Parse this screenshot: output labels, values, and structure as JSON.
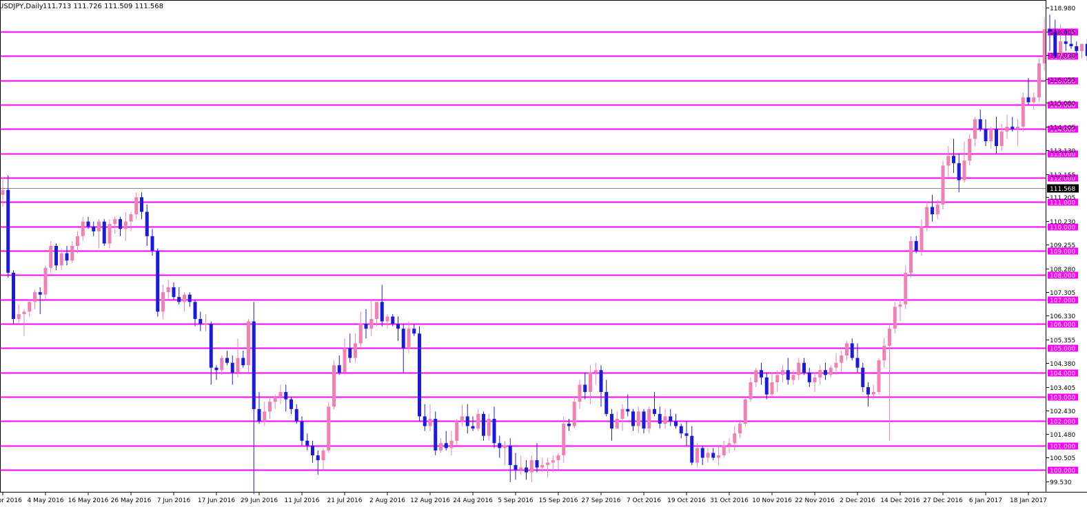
{
  "header": {
    "symbol": "USDJPY,Daily",
    "ohlc": "111.713 111.726 111.509 111.568"
  },
  "colors": {
    "bull": "#f27fb5",
    "bear": "#1a1adf",
    "level_line": "#ff00ff",
    "current_line": "#8a8a8a",
    "current_box": "#000000"
  },
  "chart_data": {
    "type": "candlestick",
    "title": "USDJPY,Daily",
    "ylim": [
      99.1,
      119.3
    ],
    "yticks": [
      "118.980",
      "118.005",
      "117.030",
      "116.055",
      "115.080",
      "114.105",
      "113.130",
      "112.155",
      "111.205",
      "110.230",
      "109.255",
      "108.280",
      "107.305",
      "106.330",
      "105.355",
      "104.380",
      "103.405",
      "102.430",
      "101.480",
      "100.505",
      "99.530"
    ],
    "level_lines": [
      "118.000",
      "117.000",
      "116.000",
      "115.000",
      "114.000",
      "113.000",
      "112.000",
      "111.000",
      "110.000",
      "109.000",
      "108.000",
      "107.000",
      "106.000",
      "105.000",
      "104.000",
      "103.000",
      "102.000",
      "101.000",
      "100.000"
    ],
    "current_price": "111.568",
    "x_labels": [
      {
        "label": "22 Apr 2016",
        "index": 0
      },
      {
        "label": "4 May 2016",
        "index": 8
      },
      {
        "label": "16 May 2016",
        "index": 16
      },
      {
        "label": "26 May 2016",
        "index": 24
      },
      {
        "label": "7 Jun 2016",
        "index": 32
      },
      {
        "label": "17 Jun 2016",
        "index": 40
      },
      {
        "label": "29 Jun 2016",
        "index": 48
      },
      {
        "label": "11 Jul 2016",
        "index": 56
      },
      {
        "label": "21 Jul 2016",
        "index": 64
      },
      {
        "label": "2 Aug 2016",
        "index": 72
      },
      {
        "label": "12 Aug 2016",
        "index": 80
      },
      {
        "label": "24 Aug 2016",
        "index": 88
      },
      {
        "label": "5 Sep 2016",
        "index": 96
      },
      {
        "label": "15 Sep 2016",
        "index": 104
      },
      {
        "label": "27 Sep 2016",
        "index": 112
      },
      {
        "label": "7 Oct 2016",
        "index": 120
      },
      {
        "label": "19 Oct 2016",
        "index": 128
      },
      {
        "label": "31 Oct 2016",
        "index": 136
      },
      {
        "label": "10 Nov 2016",
        "index": 144
      },
      {
        "label": "22 Nov 2016",
        "index": 152
      },
      {
        "label": "2 Dec 2016",
        "index": 160
      },
      {
        "label": "14 Dec 2016",
        "index": 168
      },
      {
        "label": "27 Dec 2016",
        "index": 176
      },
      {
        "label": "6 Jan 2017",
        "index": 184
      },
      {
        "label": "18 Jan 2017",
        "index": 192
      }
    ],
    "candles": [
      [
        111.3,
        112.0,
        110.8,
        111.5
      ],
      [
        111.5,
        112.1,
        107.9,
        108.1
      ],
      [
        108.1,
        108.2,
        106.0,
        106.2
      ],
      [
        106.2,
        106.8,
        106.0,
        106.4
      ],
      [
        106.4,
        106.6,
        105.5,
        106.5
      ],
      [
        106.5,
        107.0,
        106.3,
        106.9
      ],
      [
        106.9,
        107.4,
        106.6,
        107.3
      ],
      [
        107.3,
        107.5,
        106.4,
        107.2
      ],
      [
        107.2,
        108.4,
        107.0,
        108.3
      ],
      [
        108.3,
        109.4,
        108.1,
        109.2
      ],
      [
        109.2,
        109.3,
        108.2,
        108.4
      ],
      [
        108.4,
        109.1,
        108.2,
        108.9
      ],
      [
        108.9,
        109.2,
        108.4,
        108.6
      ],
      [
        108.6,
        109.4,
        108.5,
        109.2
      ],
      [
        109.2,
        109.8,
        108.9,
        109.6
      ],
      [
        109.6,
        110.4,
        109.4,
        110.2
      ],
      [
        110.2,
        110.4,
        109.9,
        110.0
      ],
      [
        110.0,
        110.2,
        109.6,
        109.8
      ],
      [
        109.8,
        110.3,
        109.1,
        110.2
      ],
      [
        110.2,
        110.3,
        109.2,
        109.3
      ],
      [
        109.3,
        110.3,
        109.1,
        110.1
      ],
      [
        110.1,
        110.4,
        109.7,
        110.3
      ],
      [
        110.3,
        110.4,
        109.6,
        109.9
      ],
      [
        109.9,
        110.6,
        109.4,
        110.2
      ],
      [
        110.2,
        110.6,
        109.8,
        110.5
      ],
      [
        110.5,
        111.4,
        110.3,
        111.2
      ],
      [
        111.2,
        111.4,
        110.3,
        110.6
      ],
      [
        110.6,
        110.9,
        109.2,
        109.6
      ],
      [
        109.6,
        109.9,
        108.8,
        109.0
      ],
      [
        109.0,
        109.1,
        106.3,
        106.5
      ],
      [
        106.5,
        107.6,
        106.2,
        107.3
      ],
      [
        107.3,
        107.8,
        107.0,
        107.5
      ],
      [
        107.5,
        107.7,
        107.0,
        107.1
      ],
      [
        107.1,
        107.5,
        106.8,
        106.9
      ],
      [
        106.9,
        107.3,
        106.5,
        107.2
      ],
      [
        107.2,
        107.3,
        106.7,
        106.9
      ],
      [
        106.9,
        107.0,
        105.9,
        106.2
      ],
      [
        106.2,
        106.5,
        105.7,
        106.0
      ],
      [
        106.0,
        106.4,
        105.7,
        106.0
      ],
      [
        106.0,
        106.1,
        103.5,
        104.2
      ],
      [
        104.2,
        104.3,
        103.7,
        104.1
      ],
      [
        104.1,
        104.7,
        103.9,
        104.6
      ],
      [
        104.6,
        104.9,
        104.3,
        104.4
      ],
      [
        104.4,
        104.7,
        103.5,
        104.0
      ],
      [
        104.0,
        105.4,
        103.8,
        104.6
      ],
      [
        104.6,
        104.9,
        104.2,
        104.3
      ],
      [
        104.3,
        106.2,
        104.0,
        106.1
      ],
      [
        106.1,
        106.9,
        99.0,
        102.5
      ],
      [
        102.5,
        103.2,
        101.9,
        102.0
      ],
      [
        102.0,
        102.8,
        101.8,
        102.4
      ],
      [
        102.4,
        103.0,
        102.1,
        102.8
      ],
      [
        102.8,
        103.1,
        102.5,
        103.0
      ],
      [
        103.0,
        103.5,
        102.7,
        103.2
      ],
      [
        103.2,
        103.5,
        102.4,
        102.9
      ],
      [
        102.9,
        103.0,
        102.3,
        102.5
      ],
      [
        102.5,
        102.7,
        101.9,
        102.0
      ],
      [
        102.0,
        102.2,
        101.0,
        101.2
      ],
      [
        101.2,
        101.5,
        100.8,
        101.0
      ],
      [
        101.0,
        101.2,
        100.3,
        100.6
      ],
      [
        100.6,
        100.8,
        99.8,
        100.4
      ],
      [
        100.4,
        100.9,
        100.0,
        100.8
      ],
      [
        100.8,
        102.8,
        100.7,
        102.6
      ],
      [
        102.6,
        104.5,
        102.5,
        104.3
      ],
      [
        104.3,
        104.7,
        103.9,
        104.0
      ],
      [
        104.0,
        105.4,
        103.9,
        105.0
      ],
      [
        105.0,
        105.6,
        104.4,
        104.6
      ],
      [
        104.6,
        105.6,
        104.4,
        105.2
      ],
      [
        105.2,
        106.5,
        105.0,
        106.0
      ],
      [
        106.0,
        106.6,
        105.4,
        105.8
      ],
      [
        105.8,
        107.0,
        105.5,
        106.2
      ],
      [
        106.2,
        106.7,
        105.9,
        106.9
      ],
      [
        106.9,
        107.6,
        105.9,
        106.1
      ],
      [
        106.1,
        106.4,
        105.8,
        106.3
      ],
      [
        106.3,
        106.4,
        105.9,
        106.0
      ],
      [
        106.0,
        106.3,
        105.3,
        105.8
      ],
      [
        105.8,
        106.0,
        104.0,
        105.0
      ],
      [
        105.0,
        106.1,
        104.8,
        105.8
      ],
      [
        105.8,
        106.0,
        105.5,
        105.6
      ],
      [
        105.6,
        105.9,
        102.0,
        102.2
      ],
      [
        102.2,
        102.7,
        101.6,
        101.8
      ],
      [
        101.8,
        102.7,
        101.6,
        102.1
      ],
      [
        102.1,
        102.4,
        100.6,
        100.8
      ],
      [
        100.8,
        101.3,
        100.7,
        101.1
      ],
      [
        101.1,
        101.6,
        100.8,
        100.9
      ],
      [
        100.9,
        101.6,
        100.6,
        101.2
      ],
      [
        101.2,
        102.1,
        101.0,
        102.0
      ],
      [
        102.0,
        102.7,
        101.8,
        102.2
      ],
      [
        102.2,
        102.7,
        101.5,
        101.8
      ],
      [
        101.8,
        102.2,
        101.6,
        101.7
      ],
      [
        101.7,
        102.5,
        101.6,
        102.3
      ],
      [
        102.3,
        102.4,
        101.2,
        101.4
      ],
      [
        101.4,
        102.3,
        101.2,
        102.1
      ],
      [
        102.1,
        102.6,
        100.9,
        101.1
      ],
      [
        101.1,
        101.4,
        100.5,
        100.9
      ],
      [
        100.9,
        101.2,
        100.2,
        101.0
      ],
      [
        101.0,
        101.3,
        99.5,
        100.2
      ],
      [
        100.2,
        100.7,
        99.6,
        100.0
      ],
      [
        100.0,
        100.6,
        99.8,
        100.1
      ],
      [
        100.1,
        100.4,
        99.6,
        99.9
      ],
      [
        99.9,
        100.6,
        99.5,
        100.4
      ],
      [
        100.4,
        101.1,
        99.9,
        100.1
      ],
      [
        100.1,
        100.5,
        99.9,
        100.2
      ],
      [
        100.2,
        100.5,
        99.7,
        100.3
      ],
      [
        100.3,
        100.6,
        99.9,
        100.4
      ],
      [
        100.4,
        100.7,
        100.0,
        100.6
      ],
      [
        100.6,
        102.2,
        100.3,
        101.9
      ],
      [
        101.9,
        102.1,
        101.6,
        101.8
      ],
      [
        101.8,
        103.0,
        101.7,
        102.8
      ],
      [
        102.8,
        103.7,
        102.5,
        103.5
      ],
      [
        103.5,
        104.0,
        102.9,
        103.2
      ],
      [
        103.2,
        104.3,
        102.7,
        104.0
      ],
      [
        104.0,
        104.4,
        103.5,
        104.1
      ],
      [
        104.1,
        104.3,
        102.6,
        103.2
      ],
      [
        103.2,
        103.7,
        102.2,
        102.3
      ],
      [
        102.3,
        102.5,
        101.2,
        101.7
      ],
      [
        101.7,
        102.4,
        101.7,
        102.1
      ],
      [
        102.1,
        102.7,
        101.6,
        102.5
      ],
      [
        102.5,
        103.1,
        102.2,
        102.4
      ],
      [
        102.4,
        102.5,
        101.6,
        101.8
      ],
      [
        101.8,
        102.6,
        101.5,
        102.4
      ],
      [
        102.4,
        102.5,
        101.5,
        101.7
      ],
      [
        101.7,
        102.6,
        101.5,
        102.5
      ],
      [
        102.5,
        103.2,
        102.2,
        102.3
      ],
      [
        102.3,
        102.6,
        101.7,
        101.9
      ],
      [
        101.9,
        102.5,
        101.7,
        102.2
      ],
      [
        102.2,
        102.5,
        101.8,
        102.0
      ],
      [
        102.0,
        102.3,
        101.7,
        101.8
      ],
      [
        101.8,
        101.9,
        101.3,
        101.5
      ],
      [
        101.5,
        102.0,
        101.0,
        101.4
      ],
      [
        101.4,
        101.8,
        100.2,
        100.3
      ],
      [
        100.3,
        101.1,
        100.1,
        100.9
      ],
      [
        100.9,
        101.0,
        100.2,
        100.5
      ],
      [
        100.5,
        100.9,
        100.3,
        100.7
      ],
      [
        100.7,
        100.9,
        100.4,
        100.5
      ],
      [
        100.5,
        101.0,
        100.2,
        100.6
      ],
      [
        100.6,
        101.2,
        100.5,
        101.0
      ],
      [
        101.0,
        101.3,
        100.7,
        101.1
      ],
      [
        101.1,
        101.8,
        100.8,
        101.5
      ],
      [
        101.5,
        102.0,
        101.3,
        101.9
      ],
      [
        101.9,
        103.0,
        101.8,
        102.9
      ],
      [
        102.9,
        103.8,
        102.8,
        103.6
      ],
      [
        103.6,
        104.2,
        103.4,
        104.1
      ],
      [
        104.1,
        104.4,
        103.5,
        103.8
      ],
      [
        103.8,
        104.0,
        102.9,
        103.1
      ],
      [
        103.1,
        104.0,
        103.0,
        103.6
      ],
      [
        103.6,
        104.1,
        103.2,
        103.9
      ],
      [
        103.9,
        104.3,
        103.6,
        104.1
      ],
      [
        104.1,
        104.6,
        103.5,
        103.7
      ],
      [
        103.7,
        104.1,
        103.5,
        103.9
      ],
      [
        103.9,
        104.6,
        103.7,
        104.4
      ],
      [
        104.4,
        104.6,
        103.9,
        104.0
      ],
      [
        104.0,
        104.2,
        103.4,
        103.6
      ],
      [
        103.6,
        104.0,
        103.2,
        103.8
      ],
      [
        103.8,
        104.3,
        103.5,
        104.1
      ],
      [
        104.1,
        104.4,
        103.7,
        103.9
      ],
      [
        103.9,
        104.3,
        103.8,
        104.2
      ],
      [
        104.2,
        104.8,
        103.9,
        104.4
      ],
      [
        104.4,
        104.9,
        104.0,
        104.7
      ],
      [
        104.7,
        105.3,
        104.5,
        105.2
      ],
      [
        105.2,
        105.4,
        104.5,
        104.6
      ],
      [
        104.6,
        105.2,
        104.0,
        104.2
      ],
      [
        104.2,
        104.4,
        103.2,
        103.4
      ],
      [
        103.4,
        103.6,
        102.6,
        103.1
      ],
      [
        103.1,
        103.5,
        102.9,
        103.2
      ],
      [
        103.2,
        104.6,
        103.1,
        104.5
      ],
      [
        104.5,
        105.4,
        104.2,
        105.1
      ],
      [
        105.1,
        106.0,
        101.2,
        105.8
      ],
      [
        105.8,
        106.9,
        105.6,
        106.7
      ],
      [
        106.7,
        107.0,
        106.1,
        106.8
      ],
      [
        106.8,
        108.4,
        106.6,
        108.1
      ],
      [
        108.1,
        109.6,
        107.9,
        109.4
      ],
      [
        109.4,
        109.6,
        108.9,
        109.0
      ],
      [
        109.0,
        110.3,
        108.8,
        110.0
      ],
      [
        110.0,
        111.0,
        109.8,
        110.8
      ],
      [
        110.8,
        111.3,
        110.2,
        110.5
      ],
      [
        110.5,
        111.1,
        110.3,
        110.9
      ],
      [
        110.9,
        112.7,
        110.7,
        112.5
      ],
      [
        112.5,
        113.3,
        112.0,
        112.9
      ],
      [
        112.9,
        113.6,
        112.2,
        112.6
      ],
      [
        112.6,
        113.0,
        111.4,
        111.9
      ],
      [
        111.9,
        113.5,
        111.8,
        112.7
      ],
      [
        112.7,
        113.8,
        112.5,
        113.6
      ],
      [
        113.6,
        114.5,
        113.3,
        114.4
      ],
      [
        114.4,
        114.8,
        113.9,
        114.0
      ],
      [
        114.0,
        114.4,
        113.3,
        113.5
      ],
      [
        113.5,
        114.1,
        113.2,
        114.0
      ],
      [
        114.0,
        114.5,
        113.0,
        113.3
      ],
      [
        113.3,
        114.2,
        113.1,
        113.9
      ],
      [
        113.9,
        114.6,
        113.6,
        114.1
      ],
      [
        114.1,
        114.5,
        113.9,
        114.0
      ],
      [
        114.0,
        114.4,
        113.3,
        114.1
      ],
      [
        114.1,
        115.5,
        113.9,
        115.3
      ],
      [
        115.3,
        116.1,
        115.0,
        115.1
      ],
      [
        115.1,
        115.5,
        114.8,
        115.3
      ],
      [
        115.3,
        116.9,
        115.1,
        116.7
      ],
      [
        116.7,
        118.6,
        116.4,
        118.1
      ],
      [
        118.1,
        118.7,
        117.2,
        118.0
      ],
      [
        118.0,
        118.5,
        116.9,
        117.0
      ],
      [
        117.0,
        118.3,
        116.8,
        117.6
      ],
      [
        117.6,
        118.1,
        117.2,
        117.5
      ],
      [
        117.5,
        117.9,
        117.3,
        117.4
      ],
      [
        117.4,
        117.6,
        117.0,
        117.2
      ],
      [
        117.2,
        117.5,
        116.9,
        117.5
      ],
      [
        117.5,
        117.7,
        116.8,
        117.0
      ],
      [
        117.0,
        117.6,
        116.2,
        116.5
      ],
      [
        116.5,
        117.1,
        116.3,
        116.8
      ],
      [
        116.8,
        117.8,
        116.6,
        117.6
      ],
      [
        117.6,
        118.6,
        117.4,
        117.9
      ],
      [
        117.9,
        118.3,
        117.0,
        117.1
      ],
      [
        117.1,
        117.5,
        115.2,
        115.3
      ],
      [
        115.3,
        117.0,
        115.0,
        116.9
      ],
      [
        116.9,
        117.5,
        115.7,
        116.0
      ],
      [
        116.0,
        116.5,
        115.3,
        115.8
      ],
      [
        115.8,
        116.2,
        114.9,
        115.0
      ],
      [
        115.0,
        115.4,
        114.0,
        114.3
      ],
      [
        114.3,
        114.6,
        113.8,
        114.0
      ],
      [
        114.0,
        114.3,
        113.9,
        114.2
      ],
      [
        114.2,
        114.4,
        112.6,
        112.7
      ],
      [
        112.7,
        114.8,
        112.6,
        114.6
      ],
      [
        114.6,
        115.7,
        114.3,
        114.8
      ]
    ]
  }
}
